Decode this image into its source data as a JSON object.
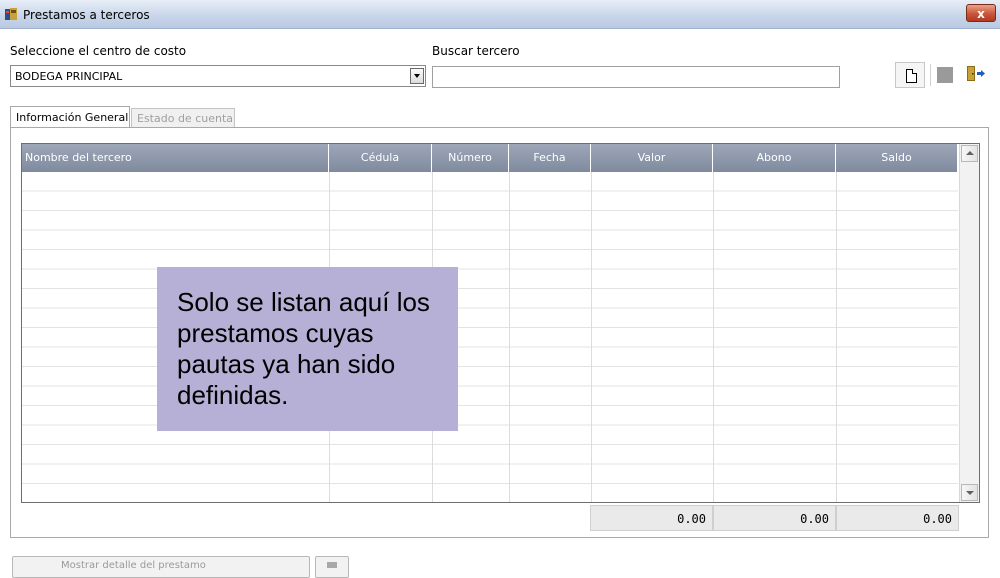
{
  "window": {
    "title": "Prestamos a terceros",
    "close_label": "x"
  },
  "form": {
    "cost_center_label": "Seleccione el centro de costo",
    "cost_center_value": "BODEGA PRINCIPAL",
    "search_label": "Buscar tercero",
    "search_value": ""
  },
  "toolbar": {
    "icons": [
      "new-document-icon",
      "stop-icon",
      "exit-door-icon"
    ]
  },
  "tabs": [
    {
      "label": "Información General",
      "active": true
    },
    {
      "label": "Estado de cuenta",
      "active": false
    }
  ],
  "grid": {
    "columns": [
      "Nombre del tercero",
      "Cédula",
      "Número",
      "Fecha",
      "Valor",
      "Abono",
      "Saldo"
    ],
    "rows": []
  },
  "totals": {
    "valor": "0.00",
    "abono": "0.00",
    "saldo": "0.00"
  },
  "note": "Solo se listan aquí los prestamos cuyas pautas ya han sido definidas.",
  "bottom": {
    "button_label": "Mostrar detalle del prestamo"
  },
  "colors": {
    "title_bar": "#c9d6ea",
    "grid_header": "#8a95a8",
    "note_background": "#b6b0d6"
  }
}
